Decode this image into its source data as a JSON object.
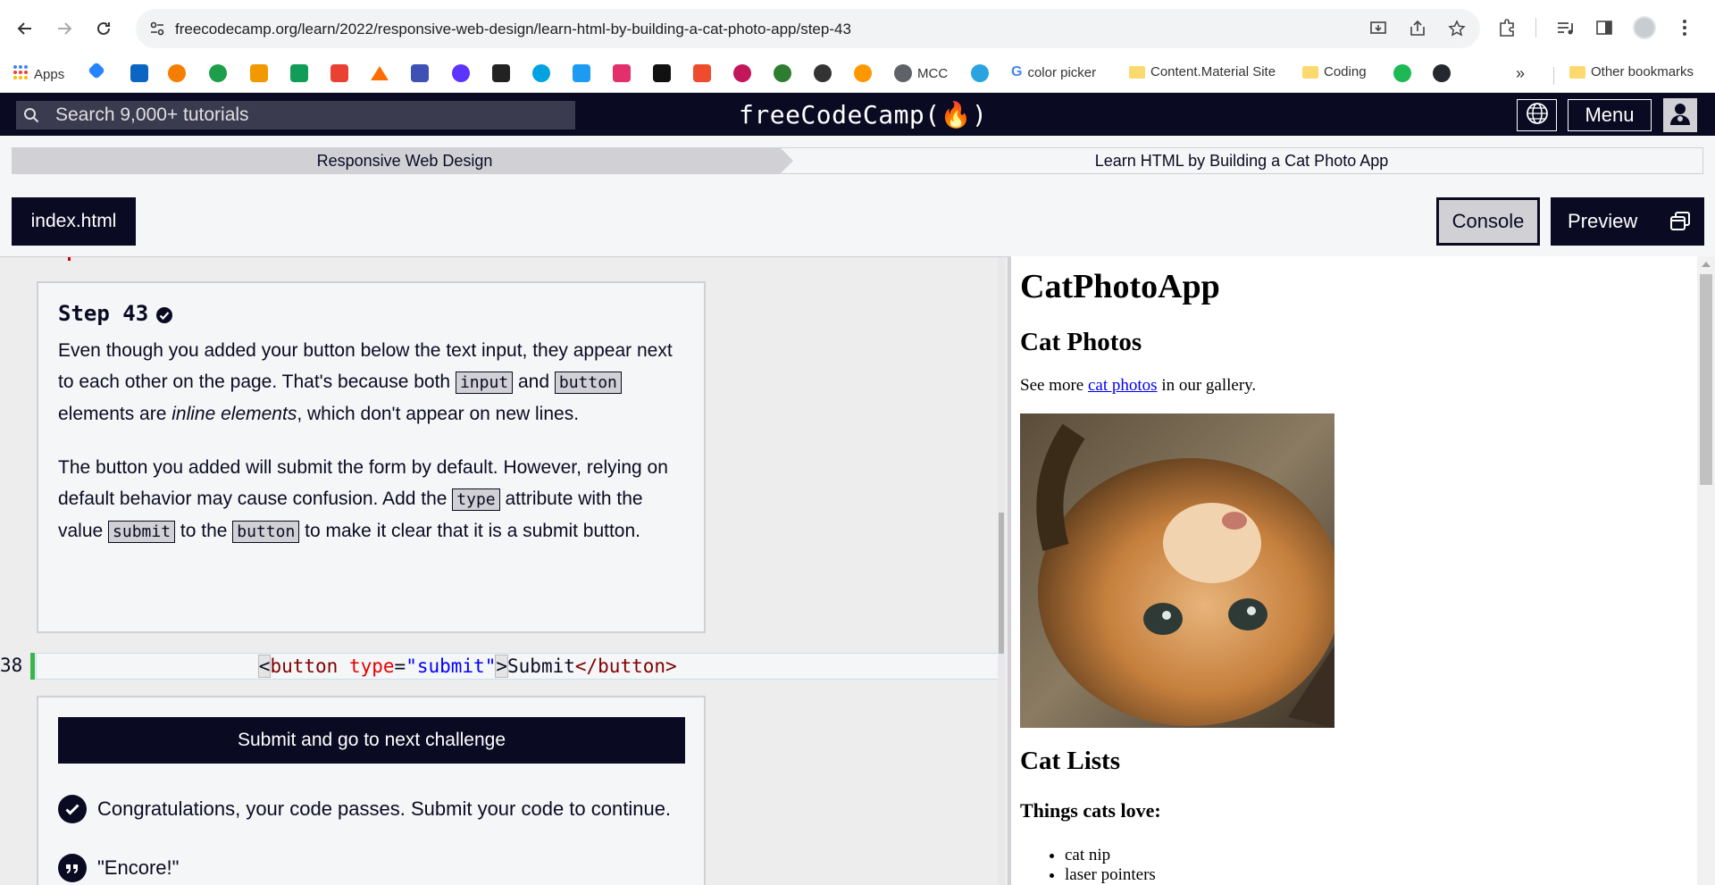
{
  "browser": {
    "url": "freecodecamp.org/learn/2022/responsive-web-design/learn-html-by-building-a-cat-photo-app/step-43",
    "bookmarks": {
      "apps": "Apps",
      "mcc": "MCC",
      "color_picker": "color picker",
      "content_material": "Content.Material Site",
      "coding": "Coding",
      "overflow": "»",
      "other": "Other bookmarks"
    }
  },
  "fcc_nav": {
    "search_placeholder": "Search 9,000+ tutorials",
    "logo": "freeCodeCamp(🔥)",
    "menu": "Menu"
  },
  "breadcrumb": {
    "superblock": "Responsive Web Design",
    "block": "Learn HTML by Building a Cat Photo App"
  },
  "tabs": {
    "file": "index.html",
    "console": "Console",
    "preview": "Preview"
  },
  "step": {
    "title": "Step 43",
    "p1": {
      "a": "Even though you added your button below the text input, they appear next to each other on the page. That's because both ",
      "code1": "input",
      "b": " and ",
      "code2": "button",
      "c": " elements are ",
      "em": "inline elements",
      "d": ", which don't appear on new lines."
    },
    "p2": {
      "a": "The button you added will submit the form by default. However, relying on default behavior may cause confusion. Add the ",
      "code1": "type",
      "b": " attribute with the value ",
      "code2": "submit",
      "c": " to the ",
      "code3": "button",
      "d": " to make it clear that it is a submit button."
    }
  },
  "code": {
    "line_number": "38",
    "indent": "         ",
    "open_lt": "<",
    "tag": "button",
    "space": " ",
    "attr": "type",
    "eq": "=",
    "value": "\"submit\"",
    "open_gt": ">",
    "text": "Submit",
    "close": "</button>"
  },
  "result": {
    "submit_button": "Submit and go to next challenge",
    "pass_message": "Congratulations, your code passes. Submit your code to continue.",
    "quote": "\"Encore!\""
  },
  "preview": {
    "h1": "CatPhotoApp",
    "h2_photos": "Cat Photos",
    "p_before": "See more ",
    "p_link": "cat photos",
    "p_after": " in our gallery.",
    "h2_lists": "Cat Lists",
    "h3_love": "Things cats love:",
    "list": [
      "cat nip",
      "laser pointers"
    ]
  },
  "colors": {
    "fcc_dark": "#0a0a23",
    "fcc_gray": "#d0d0d5",
    "pass_green": "#39b54a"
  }
}
